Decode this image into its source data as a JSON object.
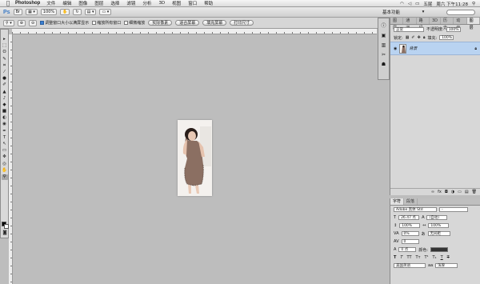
{
  "menubar": {
    "apple": "",
    "app": "Photoshop",
    "items": [
      "文件",
      "编辑",
      "图像",
      "图层",
      "选择",
      "滤镜",
      "分析",
      "3D",
      "视图",
      "窗口",
      "帮助"
    ],
    "user": "五尾",
    "clock": "周六 下午11:28"
  },
  "appbar": {
    "logo": "Ps",
    "zoom": "100%"
  },
  "essentials": {
    "label": "基本功能"
  },
  "options": {
    "resize_windows": "调整窗口大小以满屏显示",
    "zoom_all": "缩放所有窗口",
    "scrubby_zoom": "细微缩放",
    "actual_pixels": "实际像素",
    "fit_screen": "适合屏幕",
    "fill_screen": "填充屏幕",
    "print_size": "打印尺寸"
  },
  "layers_panel": {
    "tabs": [
      "图层",
      "通道",
      "路径",
      "3D",
      "历史",
      "动作",
      "图层"
    ],
    "blend_mode": "正常",
    "opacity_label": "不透明度:",
    "opacity": "100%",
    "lock_label": "锁定:",
    "fill_label": "填充:",
    "fill": "100%",
    "layer_name": "背景"
  },
  "char_panel": {
    "tabs": [
      "字符",
      "段落"
    ],
    "font": "Adobe 黑体 Std",
    "style": "-",
    "size": "26.47 点",
    "leading": "(自动)",
    "vscale": "100%",
    "hscale": "100%",
    "kerning": "0%",
    "tracking": "0",
    "mojikumi": "无间距",
    "baseline": "0 点",
    "color_label": "颜色:",
    "language": "美国英语",
    "aa": "浑厚"
  },
  "colors": {
    "accent": "#3b7fd1",
    "selection": "#b9d3f1",
    "workspace": "#bdbdbd"
  }
}
